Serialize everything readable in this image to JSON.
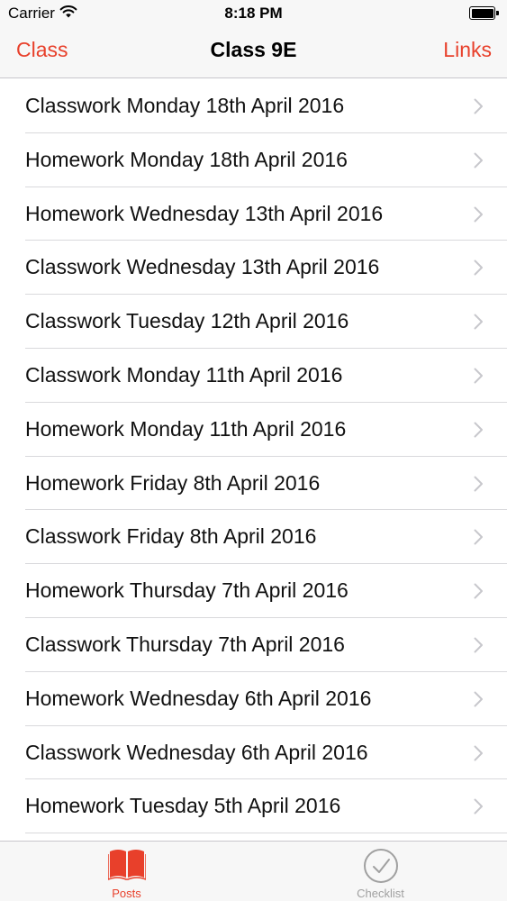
{
  "status_bar": {
    "carrier": "Carrier",
    "time": "8:18 PM"
  },
  "nav": {
    "left_label": "Class",
    "title": "Class 9E",
    "right_label": "Links"
  },
  "posts": [
    "Classwork Monday 18th April 2016",
    "Homework Monday 18th April 2016",
    "Homework Wednesday 13th April 2016",
    "Classwork Wednesday 13th April 2016",
    "Classwork Tuesday 12th April 2016",
    "Classwork Monday 11th April 2016",
    "Homework Monday 11th April 2016",
    "Homework Friday 8th April 2016",
    "Classwork Friday 8th April 2016",
    "Homework Thursday 7th April 2016",
    "Classwork Thursday 7th April 2016",
    "Homework Wednesday 6th April 2016",
    "Classwork Wednesday 6th April 2016",
    "Homework Tuesday 5th April 2016"
  ],
  "tabs": [
    {
      "label": "Posts",
      "icon": "book-icon",
      "selected": true
    },
    {
      "label": "Checklist",
      "icon": "checkmark-circle-icon",
      "selected": false
    }
  ],
  "colors": {
    "accent": "#e8402b",
    "inactive_tab": "#a0a0a0",
    "bar_background": "#f7f7f7",
    "separator": "#d9d9dc",
    "chevron": "#c7c7cc"
  }
}
